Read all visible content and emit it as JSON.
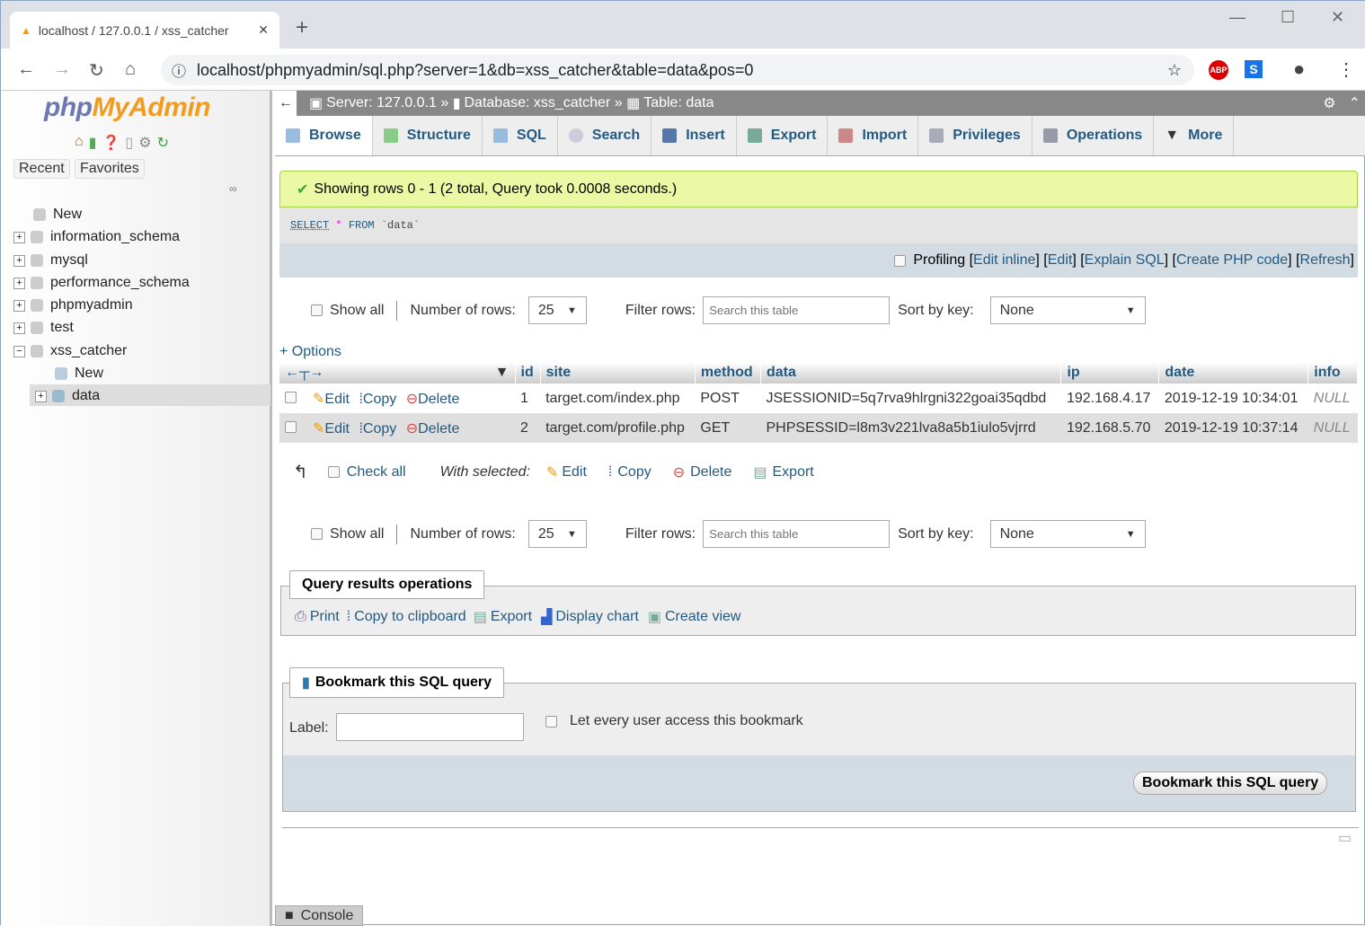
{
  "browser": {
    "tab_title": "localhost / 127.0.0.1 / xss_catcher",
    "url": "localhost/phpmyadmin/sql.php?server=1&db=xss_catcher&table=data&pos=0",
    "ext_abp": "ABP",
    "ext_s": "S"
  },
  "sidebar": {
    "logo_php": "php",
    "logo_my": "MyAdmin",
    "recent": "Recent",
    "favorites": "Favorites",
    "tree": [
      {
        "label": "New"
      },
      {
        "label": "information_schema"
      },
      {
        "label": "mysql"
      },
      {
        "label": "performance_schema"
      },
      {
        "label": "phpmyadmin"
      },
      {
        "label": "test"
      },
      {
        "label": "xss_catcher"
      },
      {
        "label": "New"
      },
      {
        "label": "data"
      }
    ]
  },
  "breadcrumb": {
    "server": "Server: 127.0.0.1",
    "database": "Database: xss_catcher",
    "table": "Table: data",
    "sep": "»"
  },
  "tabs": [
    {
      "label": "Browse"
    },
    {
      "label": "Structure"
    },
    {
      "label": "SQL"
    },
    {
      "label": "Search"
    },
    {
      "label": "Insert"
    },
    {
      "label": "Export"
    },
    {
      "label": "Import"
    },
    {
      "label": "Privileges"
    },
    {
      "label": "Operations"
    },
    {
      "label": "More"
    }
  ],
  "message": "Showing rows 0 - 1 (2 total, Query took 0.0008 seconds.)",
  "sql": {
    "kw1": "SELECT",
    "star": "*",
    "kw2": "FROM",
    "table": "`data`"
  },
  "profiling": {
    "label": "Profiling",
    "links": [
      "Edit inline",
      "Edit",
      "Explain SQL",
      "Create PHP code",
      "Refresh"
    ]
  },
  "nav": {
    "show_all": "Show all",
    "num_rows_label": "Number of rows:",
    "num_rows": "25",
    "filter_label": "Filter rows:",
    "filter_placeholder": "Search this table",
    "sort_label": "Sort by key:",
    "sort_value": "None"
  },
  "options": "+ Options",
  "table": {
    "columns": [
      "id",
      "site",
      "method",
      "data",
      "ip",
      "date",
      "info"
    ],
    "actions": {
      "edit": "Edit",
      "copy": "Copy",
      "delete": "Delete"
    },
    "rows": [
      [
        "1",
        "target.com/index.php",
        "POST",
        "JSESSIONID=5q7rva9hlrgni322goai35qdbd",
        "192.168.4.17",
        "2019-12-19 10:34:01",
        "NULL"
      ],
      [
        "2",
        "target.com/profile.php",
        "GET",
        "PHPSESSID=l8m3v221lva8a5b1iulo5vjrrd",
        "192.168.5.70",
        "2019-12-19 10:37:14",
        "NULL"
      ]
    ]
  },
  "bulk": {
    "check_all": "Check all",
    "with_selected": "With selected:",
    "edit": "Edit",
    "copy": "Copy",
    "delete": "Delete",
    "export": "Export"
  },
  "qro": {
    "legend": "Query results operations",
    "print": "Print",
    "copy": "Copy to clipboard",
    "export": "Export",
    "chart": "Display chart",
    "view": "Create view"
  },
  "bookmark": {
    "legend": "Bookmark this SQL query",
    "label": "Label:",
    "share": "Let every user access this bookmark",
    "button": "Bookmark this SQL query"
  },
  "console": "Console"
}
